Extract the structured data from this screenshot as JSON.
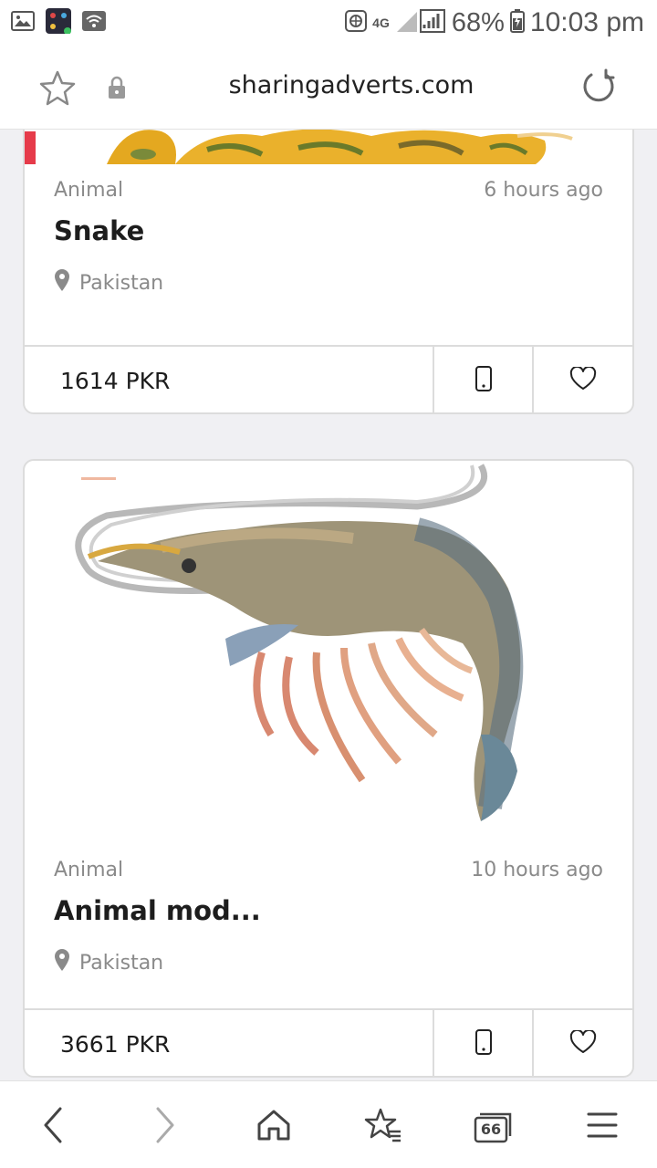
{
  "status_bar": {
    "network": "4G",
    "battery": "68%",
    "time": "10:03 pm",
    "icons": [
      "gallery-icon",
      "app-icon",
      "wifi-icon",
      "vpn-globe-icon",
      "signal-icon",
      "battery-icon"
    ]
  },
  "url_bar": {
    "url": "sharingadverts.com",
    "icons": [
      "bookmark-star-icon",
      "lock-icon",
      "reload-icon"
    ]
  },
  "listings": [
    {
      "category": "Animal",
      "time": "6 hours ago",
      "title": "Snake",
      "location": "Pakistan",
      "price": "1614 PKR"
    },
    {
      "category": "Animal",
      "time": "10 hours ago",
      "title": "Animal mod...",
      "location": "Pakistan",
      "price": "3661 PKR"
    }
  ],
  "bottom_nav": {
    "tab_count": "66",
    "icons": [
      "back-icon",
      "forward-icon",
      "home-icon",
      "bookmarks-icon",
      "tabs-icon",
      "menu-icon"
    ]
  },
  "colors": {
    "accent_price": "#1d1d1d",
    "muted": "#8a8a8a",
    "border": "#dcdcdc"
  }
}
